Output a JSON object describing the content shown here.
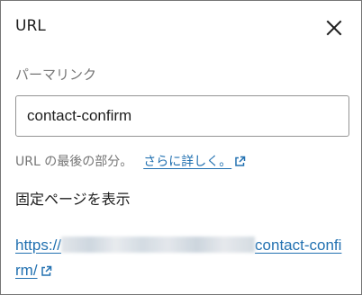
{
  "dialog": {
    "title": "URL",
    "close_icon": "close-icon"
  },
  "permalink_field": {
    "label": "パーマリンク",
    "value": "contact-confirm"
  },
  "help": {
    "text": "URL の最後の部分。",
    "link_text": "さらに詳しく。",
    "link_icon": "external-link-icon"
  },
  "view_page": {
    "label": "固定ページを表示",
    "url_prefix": "https://",
    "url_slug": "contact-confirm/",
    "link_icon": "external-link-icon"
  },
  "colors": {
    "link": "#2271b1",
    "muted": "#757575",
    "border": "#949494"
  }
}
